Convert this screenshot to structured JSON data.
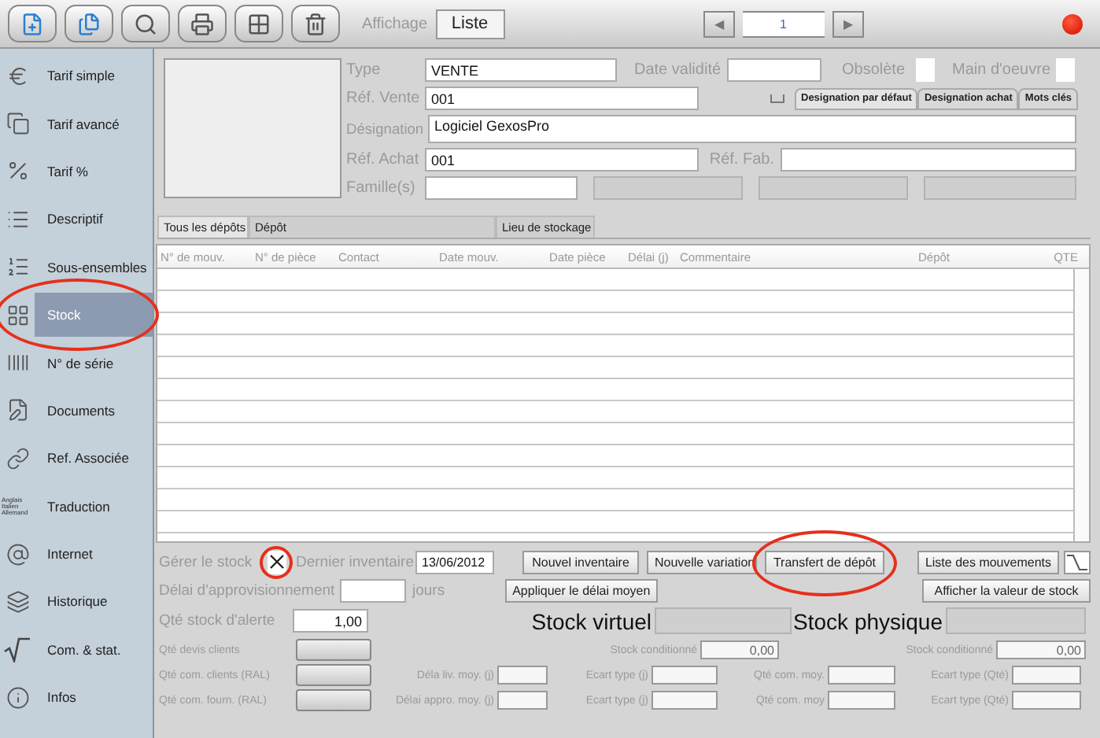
{
  "toolbar": {
    "display_label": "Affichage",
    "display_button": "Liste",
    "pager": {
      "prev": "◀",
      "page": "1",
      "next": "▶"
    }
  },
  "sidebar": {
    "items": [
      {
        "label": "Tarif simple",
        "selected": false,
        "circled": false
      },
      {
        "label": "Tarif avancé",
        "selected": false,
        "circled": false
      },
      {
        "label": "Tarif %",
        "selected": false,
        "circled": false
      },
      {
        "label": "Descriptif",
        "selected": false,
        "circled": false
      },
      {
        "label": "Sous-ensembles",
        "selected": false,
        "circled": false
      },
      {
        "label": "Stock",
        "selected": true,
        "circled": true
      },
      {
        "label": "N° de série",
        "selected": false,
        "circled": false
      },
      {
        "label": "Documents",
        "selected": false,
        "circled": false
      },
      {
        "label": "Ref. Associée",
        "selected": false,
        "circled": false
      },
      {
        "label": "Traduction",
        "selected": false,
        "circled": false,
        "icon_lines": [
          "Anglais",
          "Italien",
          "Allemand"
        ]
      },
      {
        "label": "Internet",
        "selected": false,
        "circled": false
      },
      {
        "label": "Historique",
        "selected": false,
        "circled": false
      },
      {
        "label": "Com. & stat.",
        "selected": false,
        "circled": false
      },
      {
        "label": "Infos",
        "selected": false,
        "circled": false
      }
    ]
  },
  "article": {
    "type": {
      "label": "Type",
      "value": "VENTE"
    },
    "date_validity": {
      "label": "Date validité"
    },
    "obsolete": {
      "label": "Obsolète",
      "checked": false
    },
    "labour": {
      "label": "Main d'oeuvre",
      "checked": false
    },
    "sale_ref": {
      "label": "Réf. Vente",
      "value": "001"
    },
    "designation_tabs": [
      {
        "label": "Designation par défaut",
        "selected": true
      },
      {
        "label": "Designation achat",
        "selected": false
      },
      {
        "label": "Mots clés",
        "selected": false
      }
    ],
    "designation": {
      "label": "Désignation",
      "value": "Logiciel GexosPro"
    },
    "purchase_ref": {
      "label": "Réf. Achat",
      "value": "001"
    },
    "maker_ref": {
      "label": "Réf. Fab."
    },
    "families": {
      "label": "Famille(s)"
    }
  },
  "stock_tabs": [
    {
      "label": "Tous les dépôts",
      "selected": true
    },
    {
      "label": "Dépôt",
      "selected": false
    },
    {
      "label": "Lieu de stockage",
      "selected": false
    }
  ],
  "table": {
    "columns": [
      "N° de mouv.",
      "N° de pièce",
      "Contact",
      "Date mouv.",
      "Date pièce",
      "Délai (j)",
      "Commentaire",
      "Dépôt",
      "QTE"
    ]
  },
  "stock_panel": {
    "manage_stock": {
      "label": "Gérer le stock",
      "checked": true,
      "circled": true
    },
    "last_inventory": {
      "label": "Dernier inventaire",
      "value": "13/06/2012"
    },
    "actions": [
      {
        "label": "Nouvel inventaire",
        "circled": false
      },
      {
        "label": "Nouvelle variation",
        "circled": false
      },
      {
        "label": "Transfert de dépôt",
        "circled": true
      }
    ],
    "movements_button": "Liste des mouvements",
    "lead_time": {
      "label": "Délai d'approvisionnement",
      "unit": "jours"
    },
    "apply_button": "Appliquer le délai moyen",
    "value_button": "Afficher la valeur de stock",
    "alert_qty": {
      "label": "Qté stock d'alerte",
      "value": "1,00"
    },
    "virtual_stock": {
      "label": "Stock virtuel"
    },
    "physical_stock": {
      "label": "Stock physique"
    },
    "stats_rows": [
      [
        {
          "label": "Qté devis clients",
          "kind": "readout"
        },
        {
          "label": "Stock conditionné",
          "kind": "field",
          "value": "0,00"
        },
        {
          "label": "Stock conditionné",
          "kind": "field",
          "value": "0,00"
        }
      ],
      [
        {
          "label": "Qté com. clients (RAL)",
          "kind": "readout"
        },
        {
          "label": "Déla liv. moy. (j)",
          "kind": "field"
        },
        {
          "label": "Ecart type (j)",
          "kind": "field"
        },
        {
          "label": "Qté com. moy.",
          "kind": "field"
        },
        {
          "label": "Ecart type (Qté)",
          "kind": "field"
        }
      ],
      [
        {
          "label": "Qté com. fourn. (RAL)",
          "kind": "readout"
        },
        {
          "label": "Délai appro. moy. (j)",
          "kind": "field"
        },
        {
          "label": "Ecart type (j)",
          "kind": "field"
        },
        {
          "label": "Qté com. moy",
          "kind": "field"
        },
        {
          "label": "Ecart type (Qté)",
          "kind": "field"
        }
      ]
    ]
  }
}
